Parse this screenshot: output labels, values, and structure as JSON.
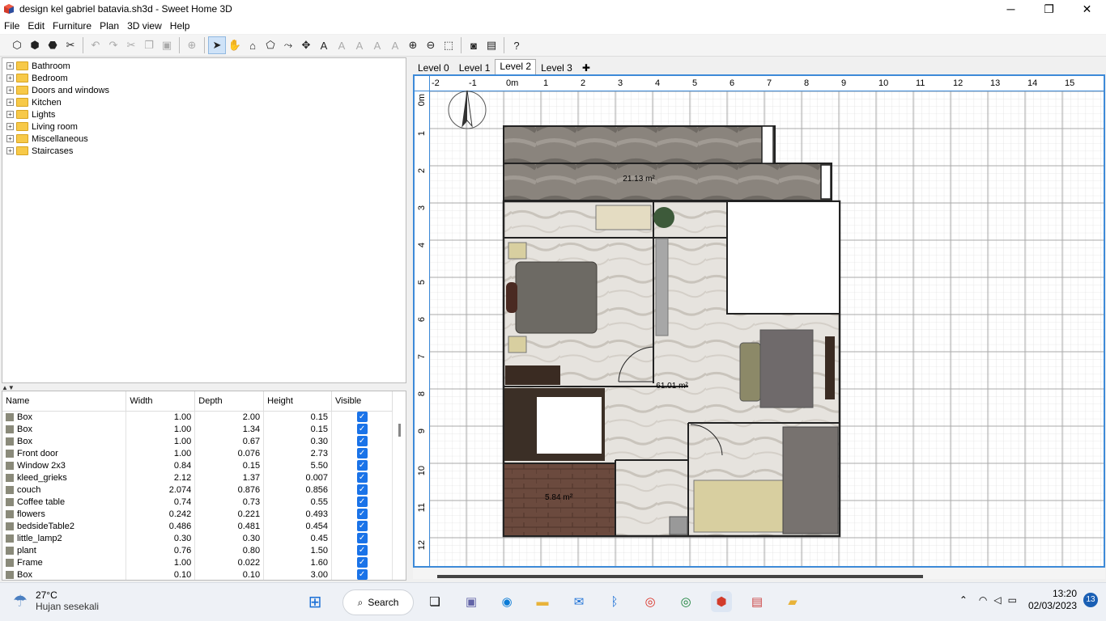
{
  "window": {
    "title": "design kel gabriel batavia.sh3d - Sweet Home 3D",
    "minimize": "─",
    "maximize": "❐",
    "close": "✕"
  },
  "menu": [
    "File",
    "Edit",
    "Furniture",
    "Plan",
    "3D view",
    "Help"
  ],
  "catalog": [
    "Bathroom",
    "Bedroom",
    "Doors and windows",
    "Kitchen",
    "Lights",
    "Living room",
    "Miscellaneous",
    "Staircases"
  ],
  "furniture_table": {
    "columns": [
      "Name",
      "Width",
      "Depth",
      "Height",
      "Visible"
    ],
    "rows": [
      {
        "name": "Box",
        "width": "1.00",
        "depth": "2.00",
        "height": "0.15"
      },
      {
        "name": "Box",
        "width": "1.00",
        "depth": "1.34",
        "height": "0.15"
      },
      {
        "name": "Box",
        "width": "1.00",
        "depth": "0.67",
        "height": "0.30"
      },
      {
        "name": "Front door",
        "width": "1.00",
        "depth": "0.076",
        "height": "2.73"
      },
      {
        "name": "Window 2x3",
        "width": "0.84",
        "depth": "0.15",
        "height": "5.50"
      },
      {
        "name": "kleed_grieks",
        "width": "2.12",
        "depth": "1.37",
        "height": "0.007"
      },
      {
        "name": "couch",
        "width": "2.074",
        "depth": "0.876",
        "height": "0.856"
      },
      {
        "name": "Coffee table",
        "width": "0.74",
        "depth": "0.73",
        "height": "0.55"
      },
      {
        "name": "flowers",
        "width": "0.242",
        "depth": "0.221",
        "height": "0.493"
      },
      {
        "name": "bedsideTable2",
        "width": "0.486",
        "depth": "0.481",
        "height": "0.454"
      },
      {
        "name": "little_lamp2",
        "width": "0.30",
        "depth": "0.30",
        "height": "0.45"
      },
      {
        "name": "plant",
        "width": "0.76",
        "depth": "0.80",
        "height": "1.50"
      },
      {
        "name": "Frame",
        "width": "1.00",
        "depth": "0.022",
        "height": "1.60"
      },
      {
        "name": "Box",
        "width": "0.10",
        "depth": "0.10",
        "height": "3.00"
      }
    ]
  },
  "levels": [
    "Level 0",
    "Level 1",
    "Level 2",
    "Level 3"
  ],
  "active_level": "Level 2",
  "add_level": "✚",
  "ruler": {
    "h_labels": [
      "-2",
      "-1",
      "0m",
      "1",
      "2",
      "3",
      "4",
      "5",
      "6",
      "7",
      "8",
      "9",
      "10",
      "11",
      "12",
      "13",
      "14",
      "15"
    ],
    "v_labels": [
      "0m",
      "1",
      "2",
      "3",
      "4",
      "5",
      "6",
      "7",
      "8",
      "9",
      "10",
      "11",
      "12"
    ]
  },
  "rooms": {
    "top_area": "21.13 m²",
    "main_area": "61.01 m²",
    "small_area": "5.84 m²"
  },
  "taskbar": {
    "weather_temp": "27°C",
    "weather_desc": "Hujan sesekali",
    "search_label": "Search",
    "time": "13:20",
    "date": "02/03/2023",
    "notifications": "13"
  }
}
